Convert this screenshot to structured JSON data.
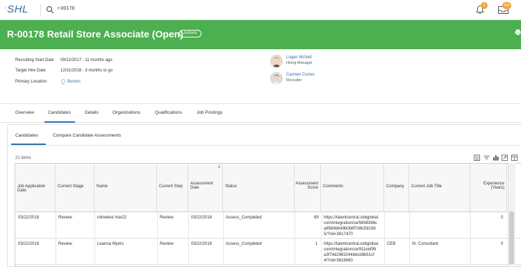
{
  "topbar": {
    "logo": "SHL",
    "search_value": "r-00178",
    "notifications_count": "1",
    "inbox_count": "155"
  },
  "header": {
    "title": "R-00178 Retail Store Associate (Open)",
    "actions_label": "Actions"
  },
  "details": {
    "recruiting_start_label": "Recruiting Start Date",
    "recruiting_start_value": "09/22/2017 - 11 months ago",
    "target_hire_label": "Target Hire Date",
    "target_hire_value": "12/31/2018 - 3 months to go",
    "primary_location_label": "Primary Location",
    "primary_location_value": "Boston"
  },
  "people": [
    {
      "name": "Logan McNeil",
      "role": "Hiring Manager"
    },
    {
      "name": "Carmen Cortes",
      "role": "Recruiter"
    }
  ],
  "tabs": [
    "Overview",
    "Candidates",
    "Details",
    "Organizations",
    "Qualifications",
    "Job Postings"
  ],
  "subtabs": [
    "Candidates",
    "Compare Candidate Assessments"
  ],
  "items_count": "21 items",
  "table": {
    "headers": {
      "job_application_date": "Job Application Date",
      "current_stage": "Current Stage",
      "name": "Name",
      "current_step": "Current Step",
      "assessment_date": "Assessment Date",
      "status": "Status",
      "assessment_score": "Assessment Score",
      "comments": "Comments",
      "company": "Company",
      "current_job_title": "Current Job Title",
      "experience": "Experience (Years)"
    },
    "rows": [
      {
        "job_application_date": "03/22/2018",
        "current_stage": "Review",
        "name": "inlinetest mar22",
        "current_step": "Review",
        "assessment_date": "03/22/2018",
        "status": "Assess_Completed",
        "assessment_score": "69",
        "comments_1": "https://talentcentral.cebglobal.",
        "comments_2": "com/integration/ce/5698366c",
        "comments_3": "a8584b649b0b8f7d6c5819d",
        "comments_4": "5/?rid=3617470",
        "company": "",
        "current_job_title": "",
        "experience": "0"
      },
      {
        "job_application_date": "03/22/2018",
        "current_stage": "Review",
        "name": "Leanna Myers",
        "current_step": "Review",
        "assessment_date": "03/22/2018",
        "status": "Assess_Completed",
        "assessment_score": "1",
        "comments_1": "https://talentcentral.cebglobal.",
        "comments_2": "com/integration/ce/911eef99",
        "comments_3": "a3f74d29832448dcb9b51cf",
        "comments_4": "4/?rid=3616660",
        "company": "CEB",
        "current_job_title": "Sr. Consultant",
        "experience": "0"
      }
    ]
  }
}
